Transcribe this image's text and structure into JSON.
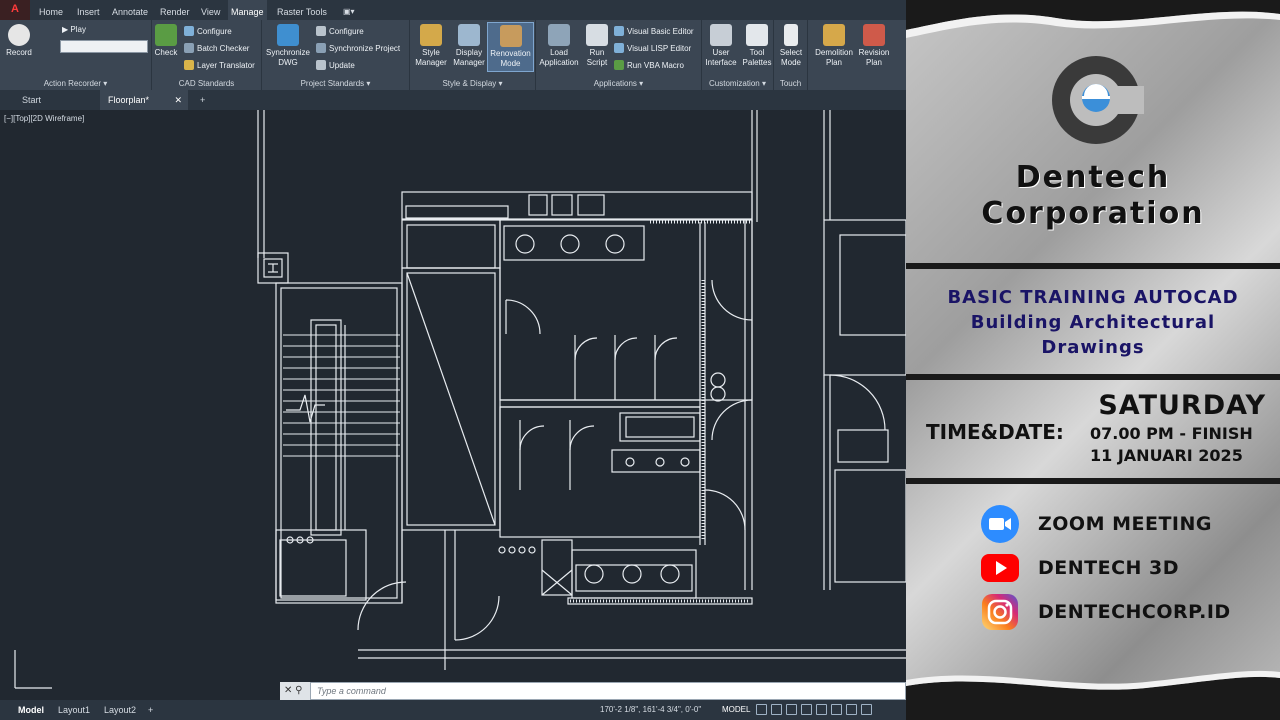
{
  "ribbon": {
    "app_logo": "A",
    "tabs": [
      "Home",
      "Insert",
      "Annotate",
      "Render",
      "View",
      "Manage",
      "Raster Tools"
    ],
    "active_tab": "Manage",
    "groups": {
      "action_recorder": {
        "title": "Action Recorder",
        "record": "Record",
        "play": "Play"
      },
      "cad_standards": {
        "title": "CAD Standards",
        "check": "Check",
        "configure": "Configure",
        "batch_checker": "Batch Checker",
        "layer_translator": "Layer Translator"
      },
      "project_standards": {
        "title": "Project Standards",
        "sync_dwg": "Synchronize DWG",
        "configure": "Configure",
        "sync_project": "Synchronize Project",
        "update": "Update"
      },
      "style_display": {
        "title": "Style & Display",
        "style_manager": "Style Manager",
        "display_manager": "Display Manager",
        "renovation_mode": "Renovation Mode"
      },
      "applications": {
        "title": "Applications",
        "load_application": "Load Application",
        "run_script": "Run Script",
        "vba_editor": "Visual Basic Editor",
        "lisp_editor": "Visual LISP Editor",
        "run_vba": "Run VBA Macro"
      },
      "customization": {
        "title": "Customization",
        "user_interface": "User Interface",
        "tool_palettes": "Tool Palettes"
      },
      "touch": {
        "title": "Touch",
        "select_mode": "Select Mode"
      },
      "extra": {
        "demolition_plan": "Demolition Plan",
        "revision_plan": "Revision Plan"
      }
    }
  },
  "doc_tabs": [
    "Start",
    "Floorplan*"
  ],
  "active_doc": "Floorplan*",
  "viewport_label": "[−][Top][2D Wireframe]",
  "command": {
    "placeholder": "Type a command"
  },
  "status": {
    "layout_tabs": [
      "Model",
      "Layout1",
      "Layout2"
    ],
    "coords": "170'-2 1/8\", 161'-4 3/4\", 0'-0\"",
    "mode": "MODEL"
  },
  "promo": {
    "company": "Dentech Corporation",
    "title": "BASIC TRAINING AUTOCAD",
    "subtitle_line1": "Building Architectural",
    "subtitle_line2": "Drawings",
    "day": "SATURDAY",
    "time_label": "TIME&DATE:",
    "time": "07.00 PM - FINISH",
    "date": "11 JANUARI 2025",
    "socials": [
      {
        "icon": "zoom-icon",
        "label": "ZOOM MEETING"
      },
      {
        "icon": "youtube-icon",
        "label": "DENTECH 3D"
      },
      {
        "icon": "instagram-icon",
        "label": "DENTECHCORP.ID"
      }
    ]
  },
  "colors": {
    "acad_bg": "#212830",
    "ribbon_bg": "#3b4653",
    "accent_title": "#1a1466",
    "zoom": "#2d8cff",
    "youtube": "#ff0000"
  }
}
